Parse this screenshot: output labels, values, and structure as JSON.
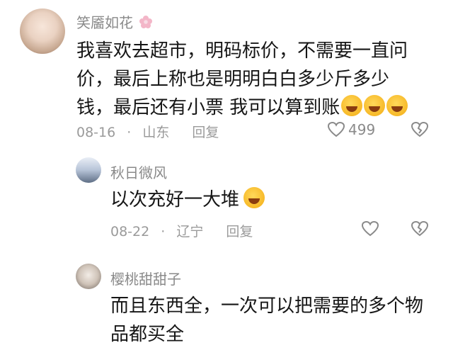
{
  "comments": [
    {
      "username": "笑靥如花",
      "lines": [
        "我喜欢去超市，明码标价，不需要一直问",
        "价，最后上称也是明明白白多少斤多少",
        "钱，最后还有小票 我可以算到账"
      ],
      "date": "08-16",
      "location": "山东",
      "reply_label": "回复",
      "like_count": "499"
    },
    {
      "username": "秋日微风",
      "lines": [
        "以次充好一大堆"
      ],
      "date": "08-22",
      "location": "辽宁",
      "reply_label": "回复",
      "like_count": ""
    },
    {
      "username": "樱桃甜甜子",
      "lines": [
        "而且东西全，一次可以把需要的多个物",
        "品都买全"
      ],
      "date": "",
      "location": "",
      "reply_label": "",
      "like_count": ""
    }
  ],
  "separator": "·",
  "icons": [
    "user-avatar",
    "flower-emoji",
    "laugh-cry-emoji",
    "heart-icon",
    "dislike-heart-icon"
  ]
}
